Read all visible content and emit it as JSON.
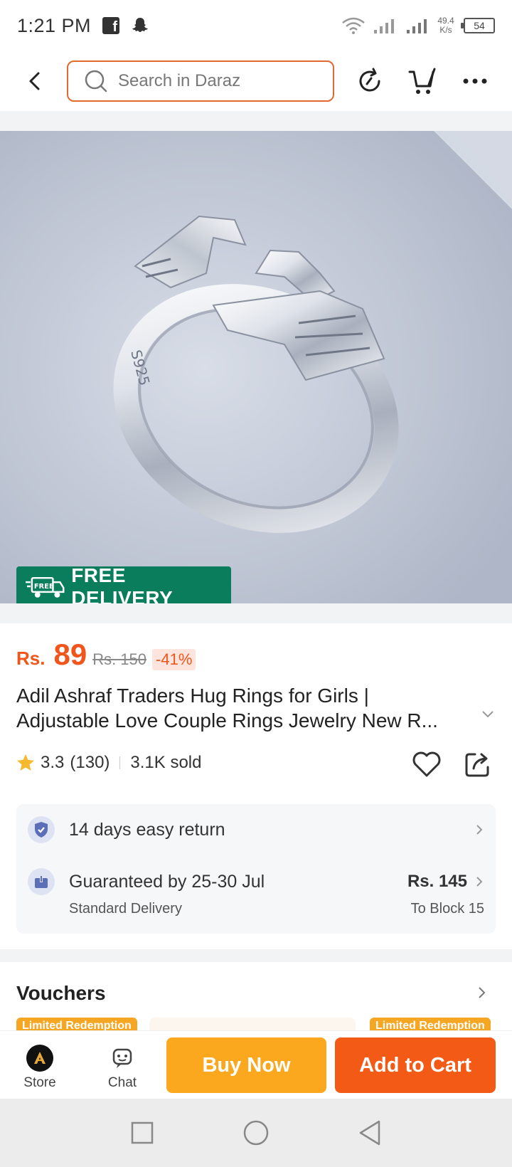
{
  "status_bar": {
    "time": "1:21 PM",
    "net_speed_value": "49.4",
    "net_speed_unit": "K/s",
    "battery": "54"
  },
  "header": {
    "search_placeholder": "Search in Daraz"
  },
  "product": {
    "badge": "FREE DELIVERY",
    "badge_icon_text": "FREE",
    "currency": "Rs.",
    "price": "89",
    "original_price": "Rs. 150",
    "discount": "-41%",
    "title_line1": "Adil Ashraf Traders Hug Rings for Girls |",
    "title_line2": "Adjustable Love Couple Rings Jewelry New R...",
    "rating": "3.3",
    "reviews": "(130)",
    "sold": "3.1K sold",
    "ring_engraving": "S925"
  },
  "services": {
    "return_text": "14 days easy return",
    "delivery_text": "Guaranteed by 25-30 Jul",
    "delivery_price": "Rs. 145",
    "delivery_type": "Standard Delivery",
    "delivery_location": "To Block 15"
  },
  "vouchers": {
    "title": "Vouchers",
    "tag_left": "Limited Redemption",
    "tag_right": "Limited Redemption"
  },
  "bottom_bar": {
    "store_label": "Store",
    "chat_label": "Chat",
    "buy_now": "Buy Now",
    "add_to_cart": "Add to Cart"
  },
  "colors": {
    "accent": "#f35a16",
    "buy_now": "#fba81f",
    "free_delivery": "#0a7d5c"
  }
}
